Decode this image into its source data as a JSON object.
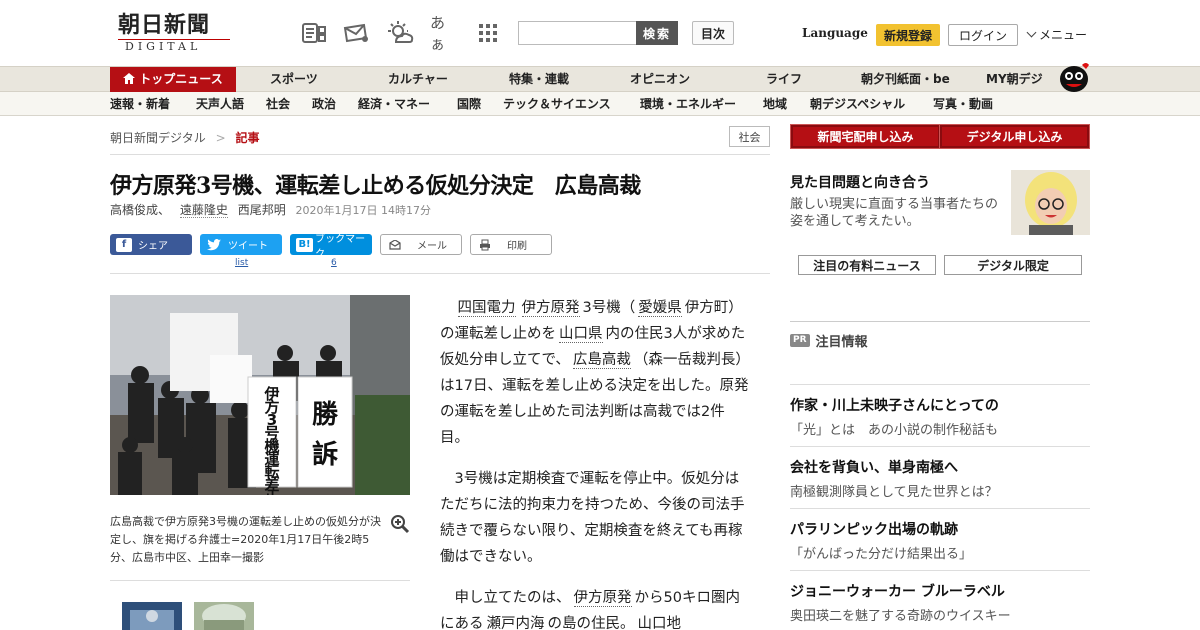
{
  "header": {
    "logo_jp": "朝日新聞",
    "logo_en": "DIGITAL",
    "search_button": "検索",
    "search_placeholder": "",
    "toc_button": "目次",
    "language": "Language",
    "register": "新規登録",
    "login": "ログイン",
    "menu": "メニュー",
    "font_size_icon_text": "あぁ"
  },
  "nav_main": [
    {
      "label": "トップニュース"
    },
    {
      "label": "スポーツ"
    },
    {
      "label": "カルチャー"
    },
    {
      "label": "特集・連載"
    },
    {
      "label": "オピニオン"
    },
    {
      "label": "ライフ"
    },
    {
      "label": "朝夕刊紙面・be"
    },
    {
      "label": "MY朝デジ"
    }
  ],
  "nav_sub": [
    {
      "label": "速報・新着"
    },
    {
      "label": "天声人語"
    },
    {
      "label": "社会"
    },
    {
      "label": "政治"
    },
    {
      "label": "経済・マネー"
    },
    {
      "label": "国際"
    },
    {
      "label": "テック＆サイエンス"
    },
    {
      "label": "環境・エネルギー"
    },
    {
      "label": "地域"
    },
    {
      "label": "朝デジスペシャル"
    },
    {
      "label": "写真・動画"
    }
  ],
  "breadcrumb": {
    "home": "朝日新聞デジタル",
    "sep": ">",
    "current": "記事",
    "category_tag": "社会"
  },
  "article": {
    "title": "伊方原発3号機、運転差し止める仮処分決定　広島高裁",
    "author1": "高橋俊成、",
    "author2": "遠藤隆史",
    "author3": "西尾邦明",
    "date": "2020年1月17日 14時17分",
    "share": {
      "facebook": "シェア",
      "twitter": "ツイート",
      "twitter_count": "list",
      "hatena": "ブックマーク",
      "hatena_count": "6",
      "mail": "メール",
      "print": "印刷"
    },
    "photo_caption": "広島高裁で伊方原発3号機の運転差し止めの仮処分が決定し、旗を掲げる弁護士=2020年1月17日午後2時5分、広島市中区、上田幸一撮影",
    "photo_sign_left": "伊方3号機運転差止",
    "photo_sign_right": "勝訴",
    "p1": {
      "a": "四国電力",
      "b": "伊方原発",
      "c": "3号機（",
      "d": "愛媛県",
      "e": "伊方町）の運転差し止めを",
      "f": "山口県",
      "g": "内の住民3人が求めた仮処分申し立てで、",
      "h": "広島高裁",
      "i": "（森一岳裁判長）は17日、運転を差し止める決定を出した。原発の運転を差し止めた司法判断は高裁では2件目。"
    },
    "p2": "3号機は定期検査で運転を停止中。仮処分はただちに法的拘束力を持つため、今後の司法手続きで覆らない限り、定期検査を終えても再稼働はできない。",
    "p3": {
      "a": "申し立てたのは、",
      "b": "伊方原発",
      "c": "から50キロ圏内にある",
      "d": "瀬戸内海",
      "e": "の島の住民。",
      "f": "山口地"
    }
  },
  "sidebar": {
    "btn_home_delivery": "新聞宅配申し込み",
    "btn_digital": "デジタル申し込み",
    "feature_title": "見た目問題と向き合う",
    "feature_desc": "厳しい現実に直面する当事者たちの姿を通して考えたい。",
    "btn_paid_news": "注目の有料ニュース",
    "btn_digital_only": "デジタル限定",
    "pr_badge": "PR",
    "pr_heading": "注目情報",
    "ads": [
      {
        "title": "作家・川上未映子さんにとっての",
        "desc": "「光」とは　あの小説の制作秘話も"
      },
      {
        "title": "会社を背負い、単身南極へ",
        "desc": "南極観測隊員として見た世界とは？"
      },
      {
        "title": "パラリンピック出場の軌跡",
        "desc": "「がんばった分だけ結果出る」"
      },
      {
        "title": "ジョニーウォーカー ブルーラベル",
        "desc": "奥田瑛二を魅了する奇跡のウイスキー"
      }
    ]
  },
  "colors": {
    "brand_red": "#b50f14",
    "register_yellow": "#f2c230",
    "facebook": "#3b5998",
    "twitter": "#1da1f2",
    "hatena": "#008fde"
  }
}
